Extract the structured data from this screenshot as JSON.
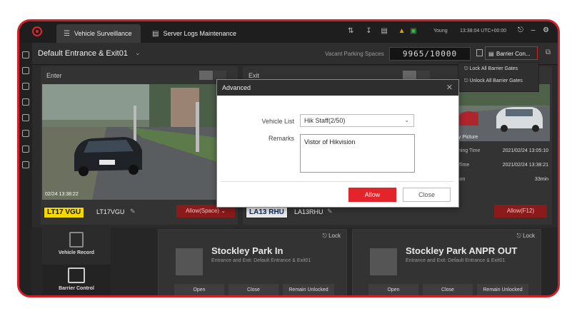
{
  "titlebar": {
    "tabs": [
      {
        "label": "Vehicle Surveillance",
        "icon": "vehicle-camera-icon"
      },
      {
        "label": "Server Logs Maintenance",
        "icon": "document-icon"
      }
    ],
    "user": "Young",
    "clock": "13:38:04 UTC+00:00"
  },
  "header": {
    "title": "Default Entrance & Exit01",
    "vacant_label": "Vacant Parking Spaces",
    "vacant_value": "9965/10000",
    "barrier_button": "Barrier Con..."
  },
  "barrier_menu": {
    "lock_all": "Lock All Barrier Gates",
    "unlock_all": "Unlock All Barrier Gates"
  },
  "entrance": {
    "title": "Enter",
    "timestamp": "02/24 13:38:22",
    "plate": "LT17 VGU",
    "plate_text": "LT17VGU",
    "allow": "Allow(Space)"
  },
  "exit": {
    "title": "Exit",
    "plate": "LA13 RHU",
    "plate_text": "LA13RHU",
    "allow": "Allow(F12)",
    "picture_label": "y Picture",
    "rows": [
      {
        "label": "ning Time",
        "value": "2021/02/24 13:05:10"
      },
      {
        "label": "Time",
        "value": "2021/02/24 13:38:21"
      },
      {
        "label": "ion",
        "value": "33min"
      }
    ]
  },
  "side_nav": {
    "vehicle_record": "Vehicle Record",
    "barrier_control": "Barrier Control"
  },
  "gates": [
    {
      "title": "Stockley Park In",
      "subtitle": "Entrance and Exit: Default Entrance & Exit01",
      "lock": "Lock",
      "buttons": [
        "Open",
        "Close",
        "Remain Unlocked"
      ]
    },
    {
      "title": "Stockley Park ANPR OUT",
      "subtitle": "Entrance and Exit: Default Entrance & Exit01",
      "lock": "Lock",
      "buttons": [
        "Open",
        "Close",
        "Remain Unlocked"
      ]
    }
  ],
  "modal": {
    "title": "Advanced",
    "vehicle_list_label": "Vehicle List",
    "vehicle_list_value": "Hik Staff(2/50)",
    "remarks_label": "Remarks",
    "remarks_value": "Vistor of Hikvision",
    "allow": "Allow",
    "close": "Close"
  },
  "colors": {
    "accent": "#e3242b",
    "dark": "#2b2b2b"
  }
}
